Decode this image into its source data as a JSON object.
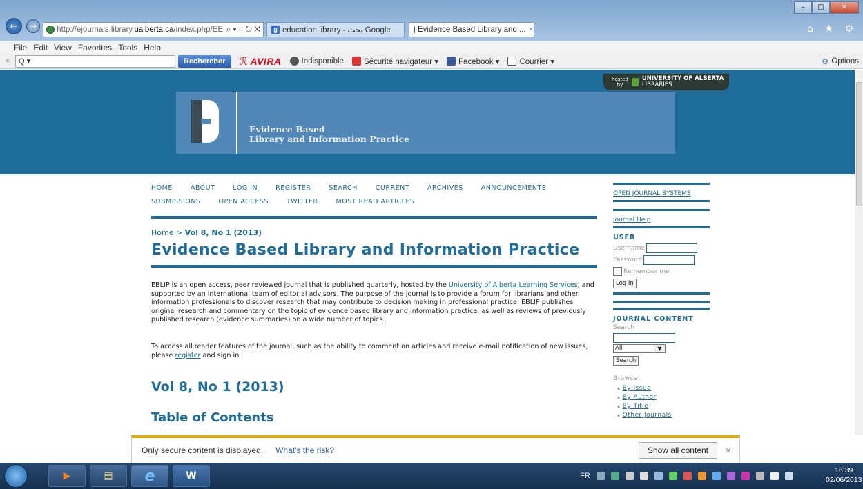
{
  "browser": {
    "address": {
      "scheme": "http://ejournals.library.",
      "host": "ualberta.ca",
      "path": "/index.php/EE",
      "controls": "⌕ ▾ ⌗ ↻ ✕"
    },
    "tabs": [
      {
        "label": "education library - بحث Google"
      },
      {
        "label": "Evidence Based Library and ...",
        "close": "×"
      }
    ],
    "window_controls": {
      "min": "–",
      "max": "□",
      "close": "✕"
    },
    "right_icons": "⌂ ★ ⚙"
  },
  "menubar": [
    "File",
    "Edit",
    "View",
    "Favorites",
    "Tools",
    "Help"
  ],
  "toolbar": {
    "close_mark": "×",
    "search_placeholder": "Q ▾",
    "search_button": "Rechercher",
    "avira": "AVIRA",
    "indisponible": "Indisponible",
    "securite": "Sécurité navigateur ▾",
    "facebook": "Facebook ▾",
    "courrier": "Courrier ▾",
    "options": "Options"
  },
  "hosted": {
    "line1": "hosted",
    "line2": "by",
    "uni": "UNIVERSITY OF ALBERTA",
    "lib": "LIBRARIES"
  },
  "logo": {
    "line1": "Evidence Based",
    "line2": "Library and Information Practice"
  },
  "nav": {
    "row1": [
      "HOME",
      "ABOUT",
      "LOG IN",
      "REGISTER",
      "SEARCH",
      "CURRENT",
      "ARCHIVES",
      "ANNOUNCEMENTS"
    ],
    "row2": [
      "SUBMISSIONS",
      "OPEN ACCESS",
      "TWITTER",
      "MOST READ ARTICLES"
    ]
  },
  "breadcrumb": {
    "home": "Home",
    "sep": " > ",
    "current": "Vol 8, No 1 (2013)"
  },
  "journal_title": "Evidence Based Library and Information Practice",
  "description": {
    "pre": "EBLIP is an open access, peer reviewed journal that is published quarterly, hosted by the ",
    "link": "University of Alberta Learning Services",
    "post": ", and supported by an international team of editorial advisors. The purpose of the journal is to provide a forum for librarians and other information professionals to discover research that may contribute to decision making in professional practice. EBLIP publishes original research and commentary on the topic of evidence based library and information practice, as well as reviews of previously published research (evidence summaries) on a wide number of topics."
  },
  "access": {
    "pre": "To access all reader features of the journal, such as the ability to comment on articles and receive e-mail notification of new issues, please ",
    "link": "register",
    "post": " and sign in."
  },
  "volume": "Vol 8, No 1 (2013)",
  "toc": "Table of Contents",
  "sidebar": {
    "ojs": "OPEN JOURNAL SYSTEMS",
    "help": "Journal Help",
    "user_head": "USER",
    "username": "Username",
    "password": "Password",
    "remember": "Remember me",
    "login": "Log In",
    "content_head": "JOURNAL CONTENT",
    "search_label": "Search",
    "scope": "All",
    "search_btn": "Search",
    "browse_head": "Browse",
    "browse": [
      "By Issue",
      "By Author",
      "By Title",
      "Other Journals"
    ]
  },
  "notification": {
    "text": "Only secure content is displayed.",
    "link": "What's the risk?",
    "button": "Show all content",
    "close": "×"
  },
  "taskbar": {
    "apps": [
      "▶",
      "▤",
      "e",
      "W"
    ],
    "lang": "FR",
    "time": "16:39",
    "date": "02/06/2013"
  }
}
